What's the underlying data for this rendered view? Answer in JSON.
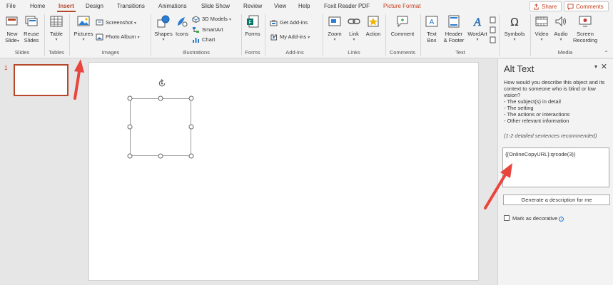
{
  "tabs": [
    "File",
    "Home",
    "Insert",
    "Design",
    "Transitions",
    "Animations",
    "Slide Show",
    "Review",
    "View",
    "Help",
    "Foxit Reader PDF",
    "Picture Format"
  ],
  "top_buttons": {
    "share": "Share",
    "comments": "Comments"
  },
  "ribbon": {
    "slides": {
      "new_slide": "New",
      "new_slide2": "Slide",
      "reuse": "Reuse",
      "reuse2": "Slides",
      "label": "Slides"
    },
    "tables": {
      "table": "Table",
      "label": "Tables"
    },
    "images": {
      "pictures": "Pictures",
      "screenshot": "Screenshot",
      "photo_album": "Photo Album",
      "label": "Images"
    },
    "illustrations": {
      "shapes": "Shapes",
      "icons": "Icons",
      "models": "3D Models",
      "smartart": "SmartArt",
      "chart": "Chart",
      "label": "Illustrations"
    },
    "forms": {
      "forms": "Forms",
      "label": "Forms"
    },
    "addins": {
      "get": "Get Add-ins",
      "my": "My Add-ins",
      "label": "Add-ins"
    },
    "links": {
      "zoom": "Zoom",
      "link": "Link",
      "action": "Action",
      "label": "Links"
    },
    "comments": {
      "comment": "Comment",
      "label": "Comments"
    },
    "text": {
      "textbox": "Text",
      "textbox2": "Box",
      "header": "Header",
      "header2": "& Footer",
      "wordart": "WordArt",
      "label": "Text"
    },
    "symbols": {
      "symbols": "Symbols",
      "label": ""
    },
    "media": {
      "video": "Video",
      "audio": "Audio",
      "screen": "Screen",
      "screen2": "Recording",
      "label": "Media"
    }
  },
  "thumbnails": {
    "slide_number": "1"
  },
  "alt_text": {
    "title": "Alt Text",
    "description": "How would you describe this object and its context to someone who is blind or low vision?",
    "bullets": [
      "- The subject(s) in detail",
      "- The setting",
      "- The actions or interactions",
      "- Other relevant information"
    ],
    "hint": "(1-2 detailed sentences recommended)",
    "value": "{{OnlineCopyURL}:qrcode(3)}",
    "generate_label": "Generate a description for me",
    "decorative_label": "Mark as decorative"
  },
  "colors": {
    "accent": "#b7472a",
    "arrow": "#e8453c",
    "link": "#2b7cd3"
  }
}
